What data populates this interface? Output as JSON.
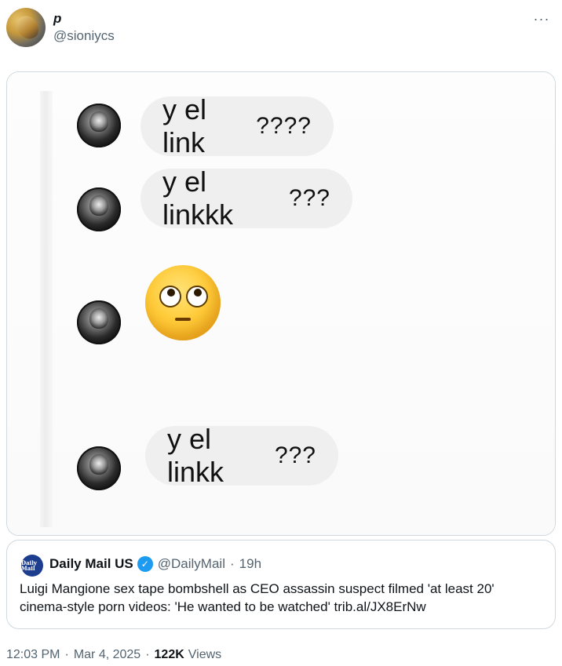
{
  "author": {
    "display_name": "p",
    "handle": "@sioniycs",
    "more_icon": "more-horizontal-icon"
  },
  "media": {
    "messages": [
      {
        "text": "y el link",
        "suffix": "????"
      },
      {
        "text": "y el linkkk",
        "suffix": "???"
      },
      {
        "emoji": "face-with-rolling-eyes"
      },
      {
        "text": "y el linkk",
        "suffix": "???"
      }
    ]
  },
  "quote": {
    "logo_text": "Daily Mail",
    "name": "Daily Mail US",
    "verified_icon": "verified-badge-icon",
    "handle": "@DailyMail",
    "separator": "·",
    "time": "19h",
    "text": "Luigi Mangione sex tape bombshell as CEO assassin suspect filmed 'at least 20' cinema-style porn videos: 'He wanted to be watched' trib.al/JX8ErNw"
  },
  "meta": {
    "time": "12:03 PM",
    "date": "Mar 4, 2025",
    "views_count": "122K",
    "views_label": "Views"
  }
}
